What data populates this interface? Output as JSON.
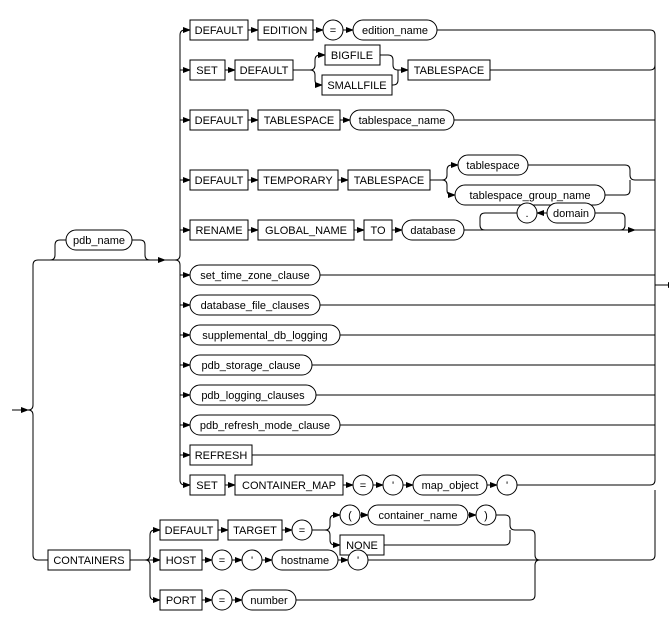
{
  "nodes": {
    "pdb_name": "pdb_name",
    "containers": "CONTAINERS",
    "default1": "DEFAULT",
    "edition": "EDITION",
    "eq1": "=",
    "edition_name": "edition_name",
    "set1": "SET",
    "default2": "DEFAULT",
    "bigfile": "BIGFILE",
    "smallfile": "SMALLFILE",
    "tablespace1": "TABLESPACE",
    "default3": "DEFAULT",
    "tablespace_kw": "TABLESPACE",
    "tablespace_name": "tablespace_name",
    "default4": "DEFAULT",
    "temporary": "TEMPORARY",
    "tablespace3": "TABLESPACE",
    "tablespace_sub": "tablespace",
    "tablespace_group_name": "tablespace_group_name",
    "rename": "RENAME",
    "global_name": "GLOBAL_NAME",
    "to": "TO",
    "database": "database",
    "dot": ".",
    "domain": "domain",
    "set_time_zone_clause": "set_time_zone_clause",
    "database_file_clauses": "database_file_clauses",
    "supplemental_db_logging": "supplemental_db_logging",
    "pdb_storage_clause": "pdb_storage_clause",
    "pdb_logging_clauses": "pdb_logging_clauses",
    "pdb_refresh_mode_clause": "pdb_refresh_mode_clause",
    "refresh": "REFRESH",
    "set2": "SET",
    "container_map": "CONTAINER_MAP",
    "eq2": "=",
    "q1": "'",
    "map_object": "map_object",
    "q2": "'",
    "default5": "DEFAULT",
    "target": "TARGET",
    "eq3": "=",
    "lparen": "(",
    "container_name": "container_name",
    "rparen": ")",
    "none": "NONE",
    "host": "HOST",
    "eq4": "=",
    "q3": "'",
    "hostname": "hostname",
    "q4": "'",
    "port": "PORT",
    "eq5": "=",
    "number": "number"
  }
}
